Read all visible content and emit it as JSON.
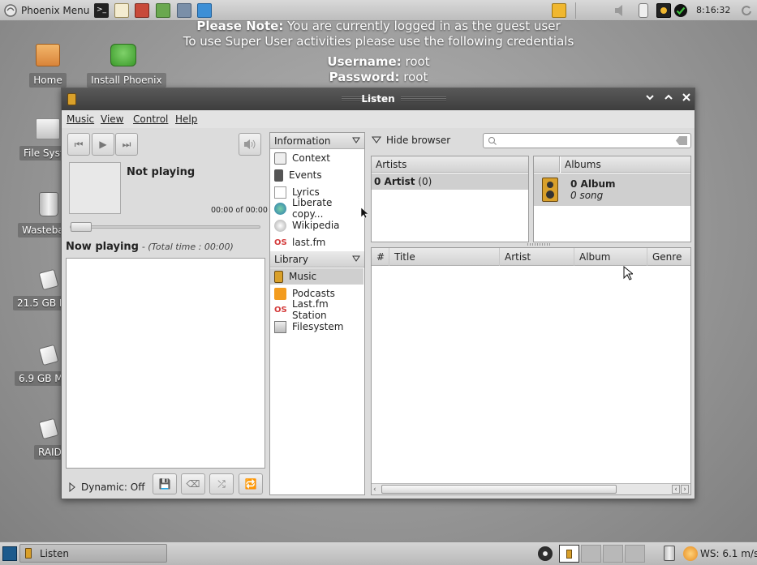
{
  "top_panel": {
    "menu_label": "Phoenix Menu",
    "clock": "8:16:32"
  },
  "notice": {
    "line1_bold": "Please Note:",
    "line1_rest": "You are currently logged in as the guest user",
    "line2": "To use Super User activities please use the following credentials",
    "username_label": "Username:",
    "username_value": "root",
    "password_label": "Password:",
    "password_value": "root"
  },
  "desktop_icons": [
    {
      "label": "Home",
      "icon": "home-folder-icon"
    },
    {
      "label": "Install Phoenix",
      "icon": "install-icon"
    },
    {
      "label": "File Syst",
      "icon": "filesystem-icon"
    },
    {
      "label": "Wastebas",
      "icon": "trash-icon"
    },
    {
      "label": "21.5 GB M",
      "icon": "drive-icon"
    },
    {
      "label": "6.9 GB Me",
      "icon": "drive-icon"
    },
    {
      "label": "RAID",
      "icon": "drive-icon"
    }
  ],
  "window": {
    "title": "Listen",
    "menus": [
      "Music",
      "View",
      "Control",
      "Help"
    ]
  },
  "player": {
    "status": "Not playing",
    "time": "00:00 of 00:00",
    "now_playing_label": "Now playing",
    "total_time": "- (Total time : 00:00)",
    "dynamic": "Dynamic: Off"
  },
  "sources": {
    "information_header": "Information",
    "information_items": [
      {
        "label": "Context",
        "icon": "home-icon"
      },
      {
        "label": "Events",
        "icon": "speaker-icon"
      },
      {
        "label": "Lyrics",
        "icon": "lyrics-icon"
      },
      {
        "label": "Liberate copy...",
        "icon": "globe-icon"
      },
      {
        "label": "Wikipedia",
        "icon": "wikipedia-icon"
      },
      {
        "label": "last.fm",
        "icon": "lastfm-icon"
      }
    ],
    "library_header": "Library",
    "library_items": [
      {
        "label": "Music",
        "icon": "speaker-icon"
      },
      {
        "label": "Podcasts",
        "icon": "rss-icon"
      },
      {
        "label": "Last.fm Station",
        "icon": "lastfm-icon"
      },
      {
        "label": "Filesystem",
        "icon": "harddisk-icon"
      }
    ]
  },
  "browser": {
    "hide_browser": "Hide browser",
    "artists_header": "Artists",
    "artist_row_bold": "0 Artist",
    "artist_row_count": "(0)",
    "albums_header": "Albums",
    "album_title": "0 Album",
    "album_sub": "0 song",
    "columns": [
      "#",
      "Title",
      "Artist",
      "Album",
      "Genre"
    ]
  },
  "taskbar": {
    "task_label": "Listen",
    "weather": "WS: 6.1 m/s"
  }
}
